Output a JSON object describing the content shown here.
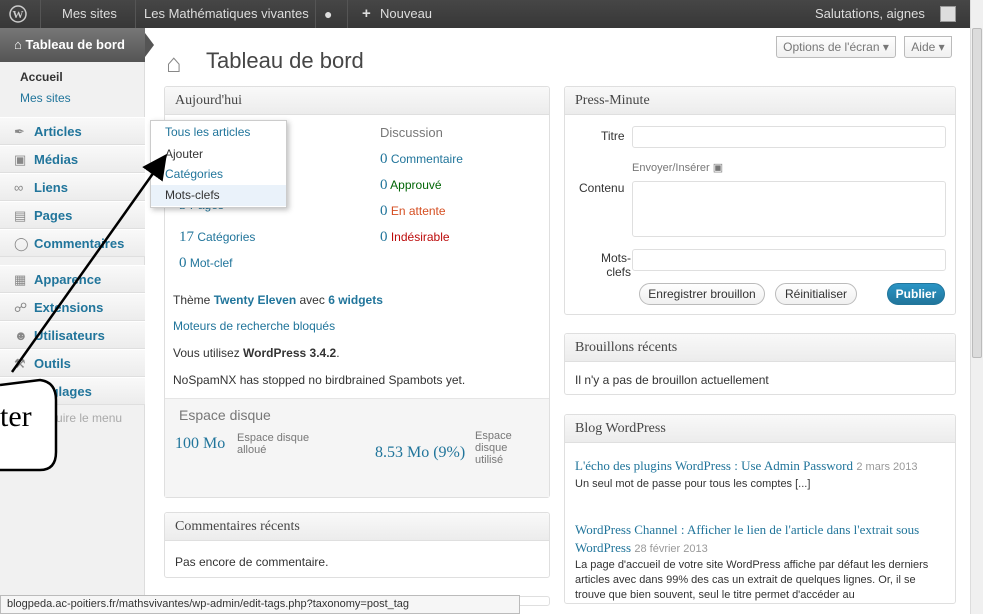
{
  "admin_bar": {
    "my_sites": "Mes sites",
    "site_name": "Les Mathématiques vivantes",
    "new": "Nouveau",
    "greeting": "Salutations, aignes"
  },
  "menu": {
    "dashboard": "Tableau de bord",
    "home": "Accueil",
    "my_sites": "Mes sites",
    "items": [
      {
        "label": "Articles",
        "icon": "pin-icon"
      },
      {
        "label": "Médias",
        "icon": "media-icon"
      },
      {
        "label": "Liens",
        "icon": "link-icon"
      },
      {
        "label": "Pages",
        "icon": "pages-icon"
      },
      {
        "label": "Commentaires",
        "icon": "comments-icon"
      },
      {
        "label": "Apparence",
        "icon": "appearance-icon"
      },
      {
        "label": "Extensions",
        "icon": "plugins-icon"
      },
      {
        "label": "Utilisateurs",
        "icon": "users-icon"
      },
      {
        "label": "Outils",
        "icon": "tools-icon"
      },
      {
        "label": "Réglages",
        "icon": "settings-icon"
      }
    ],
    "collapse": "Réduire le menu"
  },
  "flyout": [
    "Tous les articles",
    "Ajouter",
    "Catégories",
    "Mots-clefs"
  ],
  "screen_options": "Options de l'écran",
  "help": "Aide",
  "page_title": "Tableau de bord",
  "today": {
    "title": "Aujourd'hui",
    "discussion": "Discussion",
    "content_rows": [
      {
        "count": "5",
        "label": "Pages"
      },
      {
        "count": "17",
        "label": "Catégories"
      },
      {
        "count": "0",
        "label": "Mot-clef"
      }
    ],
    "discussion_rows": [
      {
        "count": "0",
        "label": "Commentaire",
        "color": "#21759b"
      },
      {
        "count": "0",
        "label": "Approuvé",
        "color": "#006505"
      },
      {
        "count": "0",
        "label": "En attente",
        "color": "#d54e21"
      },
      {
        "count": "0",
        "label": "Indésirable",
        "color": "#bc0b0b"
      }
    ],
    "theme_prefix": "Thème ",
    "theme_name": "Twenty Eleven",
    "theme_mid": " avec ",
    "widgets": "6 widgets",
    "search_blocked": "Moteurs de recherche bloqués",
    "version_prefix": "Vous utilisez ",
    "version": "WordPress 3.4.2",
    "version_suffix": ".",
    "spam": "NoSpamNX has stopped no birdbrained Spambots yet.",
    "disk_title": "Espace disque",
    "disk_alloc_value": "100 Mo",
    "disk_alloc_label": "Espace disque alloué",
    "disk_used_value": "8.53 Mo (9%)",
    "disk_used_label": "Espace disque utilisé"
  },
  "recent_comments": {
    "title": "Commentaires récents",
    "empty": "Pas encore de commentaire."
  },
  "quickpress": {
    "title": "Press-Minute",
    "label_title": "Titre",
    "upload": "Envoyer/Insérer",
    "label_content": "Contenu",
    "label_tags": "Mots-clefs",
    "save_draft": "Enregistrer brouillon",
    "reset": "Réinitialiser",
    "publish": "Publier"
  },
  "drafts": {
    "title": "Brouillons récents",
    "empty": "Il n'y a pas de brouillon actuellement"
  },
  "blog": {
    "title": "Blog WordPress",
    "posts": [
      {
        "title": "L'écho des plugins WordPress : Use Admin Password",
        "date": "2 mars 2013",
        "excerpt": "Un seul mot de passe pour tous les comptes [...]"
      },
      {
        "title": "WordPress Channel : Afficher le lien de l'article dans l'extrait sous WordPress",
        "date": "28 février 2013",
        "excerpt": "La page d'accueil de votre site WordPress affiche par défaut les derniers articles avec dans 99% des cas un extrait de quelques lignes. Or, il se trouve que bien souvent, seul le titre permet d'accéder au"
      }
    ]
  },
  "status_bar": "blogpeda.ac-poitiers.fr/mathsvivantes/wp-admin/edit-tags.php?taxonomy=post_tag",
  "annotation": {
    "callout_text": "ter"
  }
}
